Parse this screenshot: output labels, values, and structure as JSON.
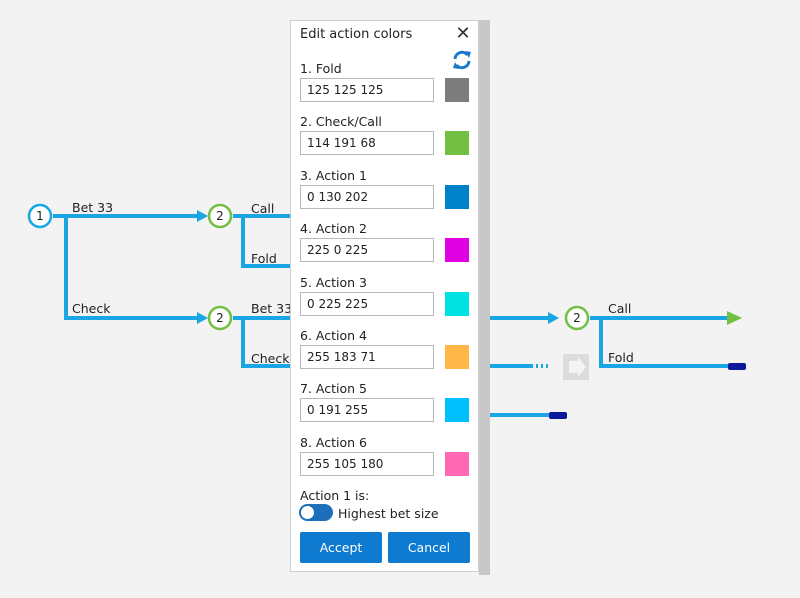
{
  "tree": {
    "labels": {
      "bet33_root": "Bet 33",
      "check_root": "Check",
      "call_a": "Call",
      "fold_a": "Fold",
      "bet33_b": "Bet 33",
      "check_b": "Check",
      "call_c": "Call",
      "fold_c": "Fold"
    },
    "nodes": {
      "root": "1",
      "n2a": "2",
      "n2b": "2",
      "n2c": "2"
    }
  },
  "dialog": {
    "title": "Edit action colors",
    "close_icon": "close-icon",
    "reset_icon": "refresh-icon",
    "rows": [
      {
        "label": "1. Fold",
        "value": "125 125 125",
        "color": "#7d7d7d"
      },
      {
        "label": "2. Check/Call",
        "value": "114 191 68",
        "color": "#72bf44"
      },
      {
        "label": "3. Action 1",
        "value": "0 130 202",
        "color": "#0082ca"
      },
      {
        "label": "4. Action 2",
        "value": "225 0 225",
        "color": "#e100e1"
      },
      {
        "label": "5. Action 3",
        "value": "0 225 225",
        "color": "#00e1e1"
      },
      {
        "label": "6. Action 4",
        "value": "255 183 71",
        "color": "#ffb747"
      },
      {
        "label": "7. Action 5",
        "value": "0 191 255",
        "color": "#00bfff"
      },
      {
        "label": "8. Action 6",
        "value": "255 105 180",
        "color": "#ff69b4"
      }
    ],
    "toggle_heading": "Action 1 is:",
    "toggle_text": "Highest bet size",
    "accept_label": "Accept",
    "cancel_label": "Cancel"
  },
  "colors": {
    "edge": "#1aa6e4",
    "node_root": "#1aa6e4",
    "node_call": "#72bf44",
    "fold_cap": "#0a1a9a",
    "button": "#0e7bd0"
  }
}
